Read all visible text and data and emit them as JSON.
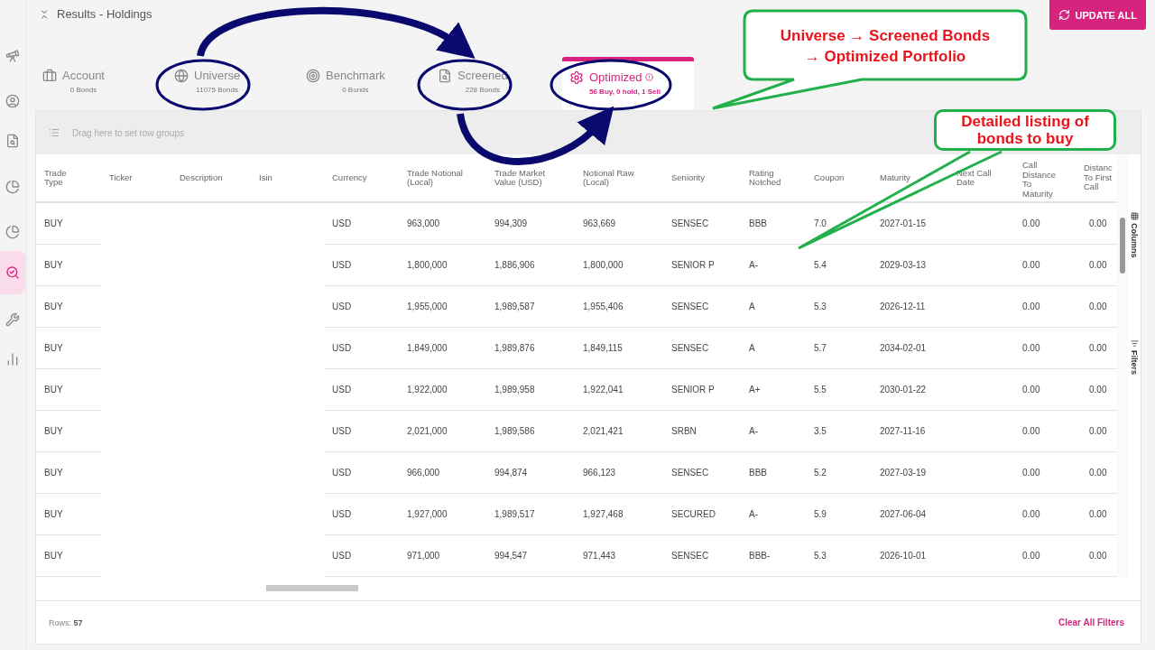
{
  "header": {
    "title": "Results - Holdings",
    "update_button": "UPDATE ALL"
  },
  "sidebar": {
    "items": [
      {
        "selected": false
      },
      {
        "selected": false
      },
      {
        "selected": false
      },
      {
        "selected": false
      },
      {
        "selected": false
      },
      {
        "selected": true
      },
      {
        "selected": false
      },
      {
        "selected": false
      }
    ]
  },
  "tabs": [
    {
      "label": "Account",
      "count": "0 Bonds",
      "selected": false,
      "alert": false
    },
    {
      "label": "Universe",
      "count": "11075 Bonds",
      "selected": false,
      "alert": false
    },
    {
      "label": "Benchmark",
      "count": "0 Bonds",
      "selected": false,
      "alert": false
    },
    {
      "label": "Screened",
      "count": "228 Bonds",
      "selected": false,
      "alert": false
    },
    {
      "label": "Optimized",
      "count": "56 Buy, 0 hold, 1 Sell",
      "selected": true,
      "alert": true
    }
  ],
  "table": {
    "group_bar": "Drag here to set row groups",
    "columns": [
      "Trade\nType",
      "Ticker",
      "Description",
      "Isin",
      "Currency",
      "Trade Notional\n(Local)",
      "Trade Market\nValue (USD)",
      "Notional Raw\n(Local)",
      "Seniority",
      "Rating\nNotched",
      "Coupon",
      "Maturity",
      "Next Call\nDate",
      "Call\nDistance\nTo\nMaturity",
      "Distanc\nTo First\nCall"
    ],
    "rows": [
      [
        "BUY",
        "",
        "",
        "",
        "USD",
        "963,000",
        "994,309",
        "963,669",
        "SENSEC",
        "BBB",
        "7.0",
        "2027-01-15",
        "",
        "0.00",
        "0.00"
      ],
      [
        "BUY",
        "",
        "",
        "",
        "USD",
        "1,800,000",
        "1,886,906",
        "1,800,000",
        "SENIOR P",
        "A-",
        "5.4",
        "2029-03-13",
        "",
        "0.00",
        "0.00"
      ],
      [
        "BUY",
        "",
        "",
        "",
        "USD",
        "1,955,000",
        "1,989,587",
        "1,955,406",
        "SENSEC",
        "A",
        "5.3",
        "2026-12-11",
        "",
        "0.00",
        "0.00"
      ],
      [
        "BUY",
        "",
        "",
        "",
        "USD",
        "1,849,000",
        "1,989,876",
        "1,849,115",
        "SENSEC",
        "A",
        "5.7",
        "2034-02-01",
        "",
        "0.00",
        "0.00"
      ],
      [
        "BUY",
        "",
        "",
        "",
        "USD",
        "1,922,000",
        "1,989,958",
        "1,922,041",
        "SENIOR P",
        "A+",
        "5.5",
        "2030-01-22",
        "",
        "0.00",
        "0.00"
      ],
      [
        "BUY",
        "",
        "",
        "",
        "USD",
        "2,021,000",
        "1,989,586",
        "2,021,421",
        "SRBN",
        "A-",
        "3.5",
        "2027-11-16",
        "",
        "0.00",
        "0.00"
      ],
      [
        "BUY",
        "",
        "",
        "",
        "USD",
        "966,000",
        "994,874",
        "966,123",
        "SENSEC",
        "BBB",
        "5.2",
        "2027-03-19",
        "",
        "0.00",
        "0.00"
      ],
      [
        "BUY",
        "",
        "",
        "",
        "USD",
        "1,927,000",
        "1,989,517",
        "1,927,468",
        "SECURED",
        "A-",
        "5.9",
        "2027-06-04",
        "",
        "0.00",
        "0.00"
      ],
      [
        "BUY",
        "",
        "",
        "",
        "USD",
        "971,000",
        "994,547",
        "971,443",
        "SENSEC",
        "BBB-",
        "5.3",
        "2026-10-01",
        "",
        "0.00",
        "0.00"
      ]
    ],
    "side_tabs": [
      "Columns",
      "Filters"
    ],
    "rows_label": "Rows:",
    "rows_count": "57",
    "clear_filters": "Clear All Filters"
  },
  "annotations": {
    "callouts": [
      {
        "lines": [
          "Universe → Screened Bonds",
          "→ Optimized Portfolio"
        ]
      },
      {
        "lines": [
          "Detailed listing of",
          "bonds to buy"
        ]
      }
    ]
  }
}
